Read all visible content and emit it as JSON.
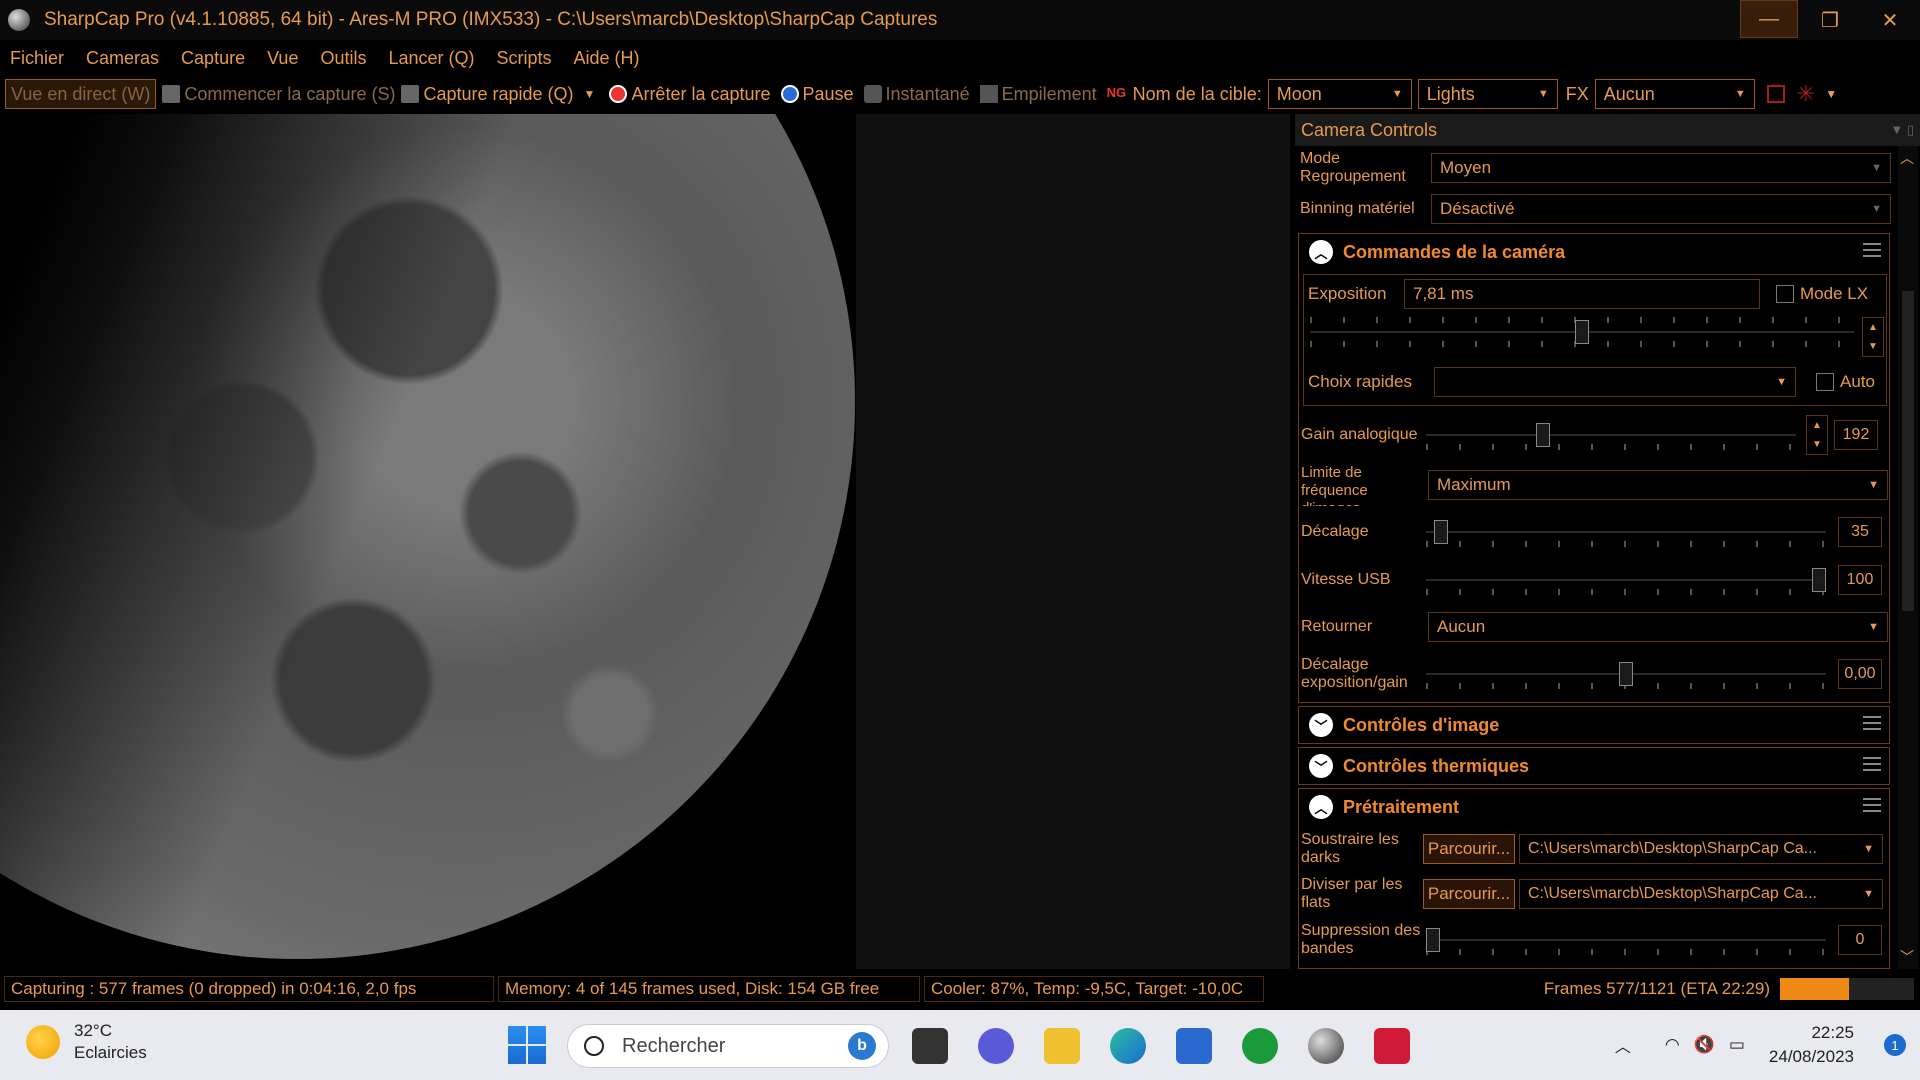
{
  "window": {
    "title": "SharpCap Pro (v4.1.10885, 64 bit) - Ares-M PRO (IMX533) - C:\\Users\\marcb\\Desktop\\SharpCap Captures",
    "controls": {
      "minimize": "—",
      "restore": "❐",
      "close": "✕"
    }
  },
  "menu": [
    "Fichier",
    "Cameras",
    "Capture",
    "Vue",
    "Outils",
    "Lancer (Q)",
    "Scripts",
    "Aide (H)"
  ],
  "toolbar": {
    "live_view": "Vue en direct (W)",
    "start_capture": "Commencer la capture (S)",
    "quick_capture": "Capture rapide (Q)",
    "stop_capture": "Arrêter la capture",
    "pause": "Pause",
    "snapshot": "Instantané",
    "stacking": "Empilement",
    "target_label": "Nom de la cible:",
    "target_value": "Moon",
    "frame_type": "Lights",
    "fx_label": "FX",
    "fx_value": "Aucun"
  },
  "panel": {
    "title": "Camera Controls",
    "binning_mode_label": "Mode Regroupement",
    "binning_mode_value": "Moyen",
    "hw_binning_label": "Binning matériel",
    "hw_binning_value": "Désactivé",
    "camera_section": {
      "title": "Commandes de la caméra",
      "exposure_label": "Exposition",
      "exposure_value": "7,81 ms",
      "lx_mode_label": "Mode LX",
      "quick_choices_label": "Choix rapides",
      "quick_choices_value": "",
      "auto_label": "Auto",
      "gain_label": "Gain analogique",
      "gain_value": "192",
      "frame_rate_label": "Limite de fréquence d'images",
      "frame_rate_value": "Maximum",
      "offset_label": "Décalage",
      "offset_value": "35",
      "usb_label": "Vitesse USB",
      "usb_value": "100",
      "flip_label": "Retourner",
      "flip_value": "Aucun",
      "exp_gain_offset_label": "Décalage exposition/gain",
      "exp_gain_offset_value": "0,00"
    },
    "image_section": {
      "title": "Contrôles d'image"
    },
    "thermal_section": {
      "title": "Contrôles thermiques"
    },
    "preprocess_section": {
      "title": "Prétraitement",
      "darks_label": "Soustraire les darks",
      "darks_button": "Parcourir...",
      "darks_path": "C:\\Users\\marcb\\Desktop\\SharpCap Ca...",
      "flats_label": "Diviser par les flats",
      "flats_button": "Parcourir...",
      "flats_path": "C:\\Users\\marcb\\Desktop\\SharpCap Ca...",
      "banding_label": "Suppression des bandes",
      "banding_value": "0"
    },
    "slider_levels": {
      "exposure": 0.5,
      "gain": 0.31,
      "offset": 0.02,
      "usb": 1.0,
      "exp_gain_offset": 0.5,
      "banding": 0.0
    }
  },
  "status": {
    "capturing": "Capturing : 577 frames (0 dropped) in 0:04:16, 2,0 fps",
    "memory": "Memory: 4 of 145 frames used, Disk: 154 GB free",
    "cooler": "Cooler: 87%, Temp: -9,5C, Target: -10,0C",
    "frames": "Frames 577/1121 (ETA 22:29)",
    "progress_fraction": 0.515
  },
  "taskbar": {
    "temperature": "32°C",
    "weather": "Eclaircies",
    "search_placeholder": "Rechercher",
    "time": "22:25",
    "date": "24/08/2023",
    "notifications": "1"
  },
  "colors": {
    "accent": "#e79a4c",
    "section_title": "#f08a2a",
    "progress": "#f08a14"
  }
}
